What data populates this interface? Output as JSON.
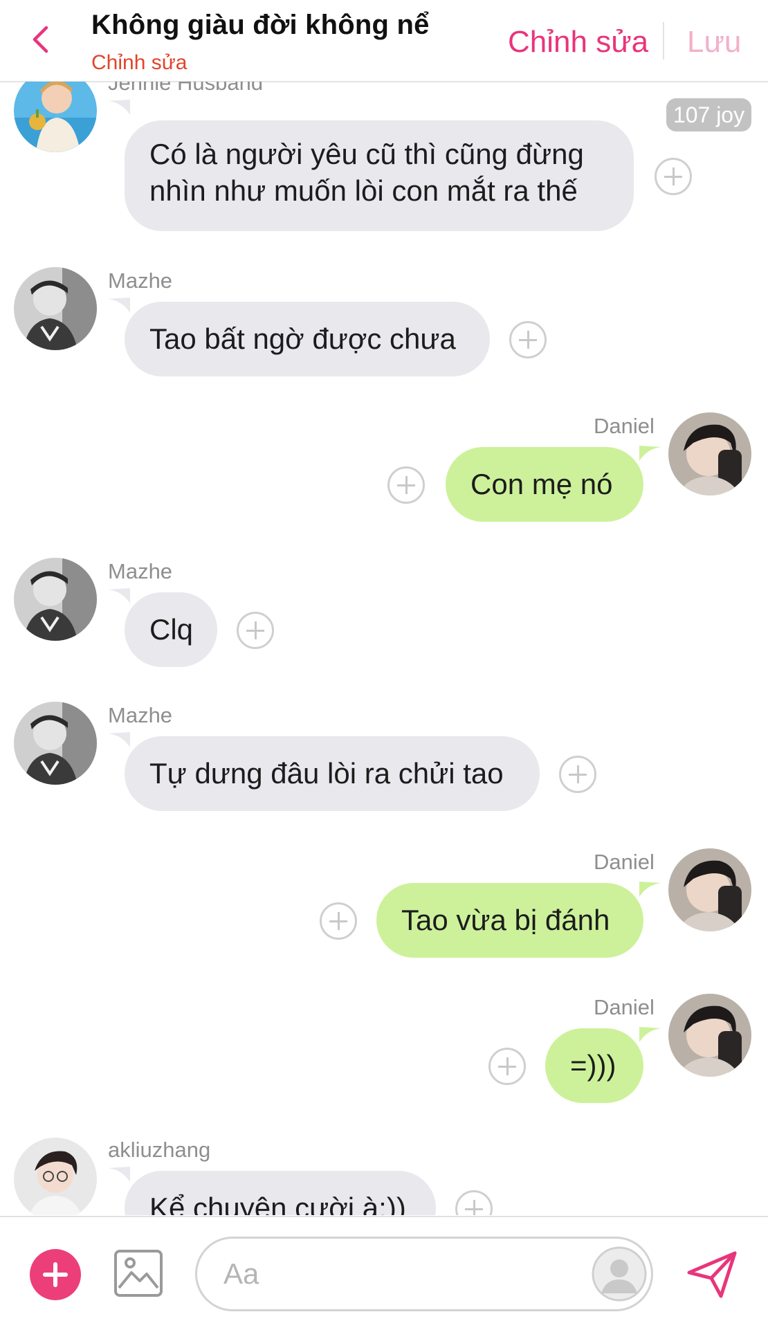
{
  "header": {
    "title": "Không giàu đời không nể",
    "subtitle": "Chỉnh sửa",
    "edit_label": "Chỉnh sửa",
    "save_label": "Lưu"
  },
  "joy_badge": "107 joy",
  "messages": [
    {
      "sender": "Jennie Husband",
      "side": "in",
      "lines": [
        "Có là người yêu cũ thì cũng đừng",
        "nhìn như muốn lòi con mắt ra thế"
      ]
    },
    {
      "sender": "Mazhe",
      "side": "in",
      "text": "Tao bất ngờ được chưa"
    },
    {
      "sender": "Daniel",
      "side": "out",
      "text": "Con mẹ nó"
    },
    {
      "sender": "Mazhe",
      "side": "in",
      "text": "Clq"
    },
    {
      "sender": "Mazhe",
      "side": "in",
      "text": "Tự dưng đâu lòi ra chửi tao"
    },
    {
      "sender": "Daniel",
      "side": "out",
      "text": "Tao vừa bị đánh"
    },
    {
      "sender": "Daniel",
      "side": "out",
      "text": "=)))"
    },
    {
      "sender": "akliuzhang",
      "side": "in",
      "text": "Kể chuyện cười à:))"
    }
  ],
  "composer": {
    "placeholder": "Aa"
  },
  "colors": {
    "accent": "#e8357b",
    "subtitle": "#e0452c",
    "incoming_bubble": "#e8e8ed",
    "outgoing_bubble": "#cdf19a"
  },
  "icons": [
    "back-chevron-icon",
    "plus-icon",
    "image-icon",
    "profile-icon",
    "send-icon"
  ]
}
